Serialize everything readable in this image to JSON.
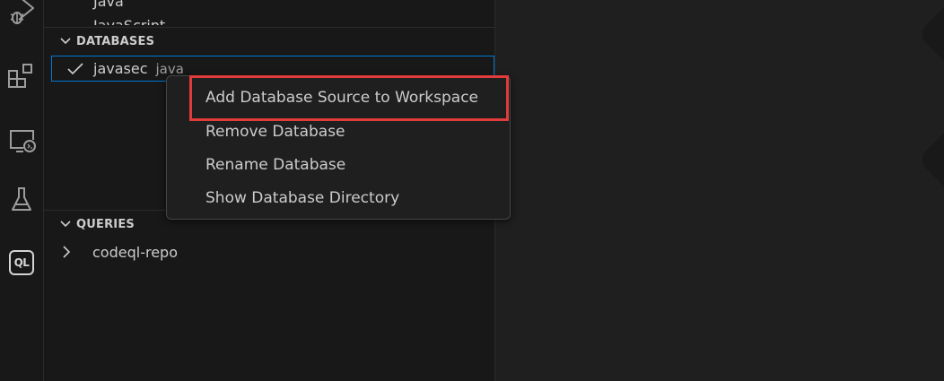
{
  "activity_bar": {
    "items": [
      {
        "icon": "run-debug-icon"
      },
      {
        "icon": "extensions-icon"
      },
      {
        "icon": "remote-explorer-icon"
      },
      {
        "icon": "testing-flask-icon"
      },
      {
        "icon": "codeql-icon",
        "label": "QL"
      }
    ]
  },
  "sidebar": {
    "languages": {
      "items": [
        "Java",
        "JavaScript"
      ]
    },
    "databases": {
      "title": "DATABASES",
      "selected_item": {
        "name": "javasec",
        "language": "java",
        "checked": true
      }
    },
    "queries": {
      "title": "QUERIES",
      "items": [
        {
          "label": "codeql-repo",
          "expanded": false
        }
      ]
    }
  },
  "context_menu": {
    "items": [
      {
        "label": "Add Database Source to Workspace",
        "highlighted": true
      },
      {
        "label": "Remove Database"
      },
      {
        "label": "Rename Database"
      },
      {
        "label": "Show Database Directory"
      }
    ]
  },
  "colors": {
    "background": "#1e1e1e",
    "sidebar": "#181818",
    "focus_border": "#0078d4",
    "annotation_red": "#e03c3c"
  }
}
